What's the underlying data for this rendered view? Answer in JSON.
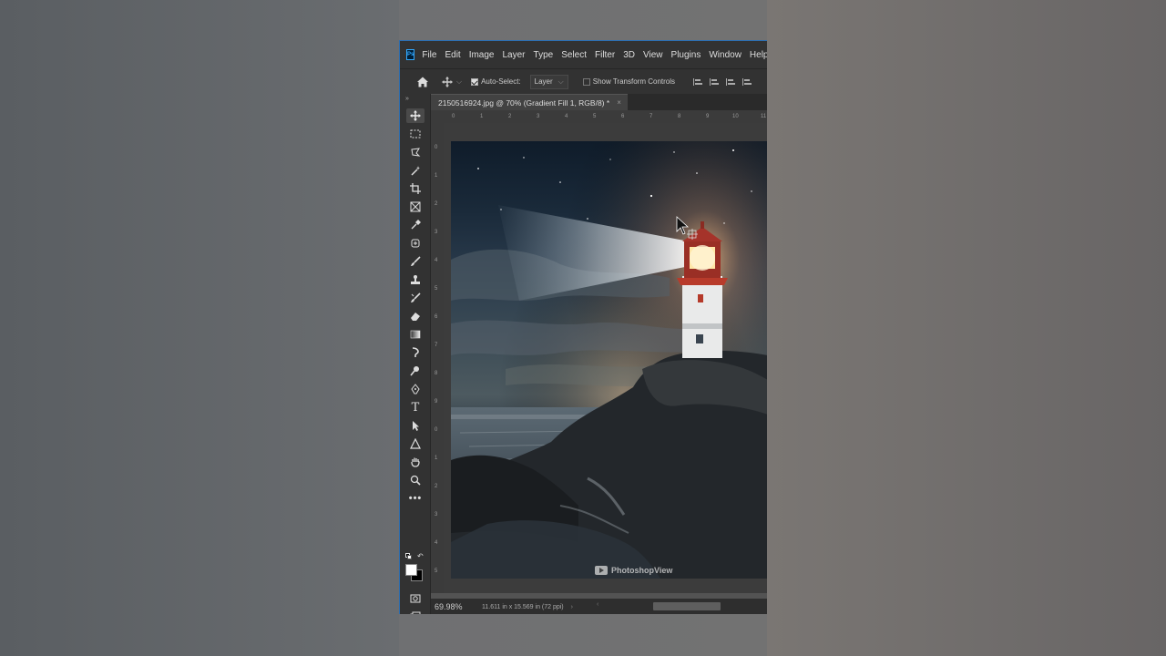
{
  "menubar": {
    "logo": "Ps",
    "items": [
      "File",
      "Edit",
      "Image",
      "Layer",
      "Type",
      "Select",
      "Filter",
      "3D",
      "View",
      "Plugins",
      "Window",
      "Help"
    ]
  },
  "options": {
    "auto_select_label": "Auto-Select:",
    "auto_select_value": "Layer",
    "transform_label": "Show Transform Controls"
  },
  "document": {
    "tab_title": "2150516924.jpg @ 70% (Gradient Fill 1, RGB/8) *",
    "close": "×"
  },
  "rulers": {
    "horizontal": [
      "0",
      "1",
      "2",
      "3",
      "4",
      "5",
      "6",
      "7",
      "8",
      "9",
      "10",
      "11"
    ],
    "vertical": [
      "0",
      "1",
      "2",
      "3",
      "4",
      "5",
      "6",
      "7",
      "8",
      "9",
      "0",
      "1",
      "2",
      "3",
      "4",
      "5"
    ]
  },
  "status": {
    "zoom": "69.98%",
    "doc_info": "11.611 in x 15.569 in (72 ppi)",
    "chevron": "›",
    "scroll_left": "‹"
  },
  "watermark": {
    "text": "PhotoshopView"
  },
  "colors": {
    "accent": "#2c6fb3",
    "chrome": "#323232",
    "canvas": "#535353"
  }
}
